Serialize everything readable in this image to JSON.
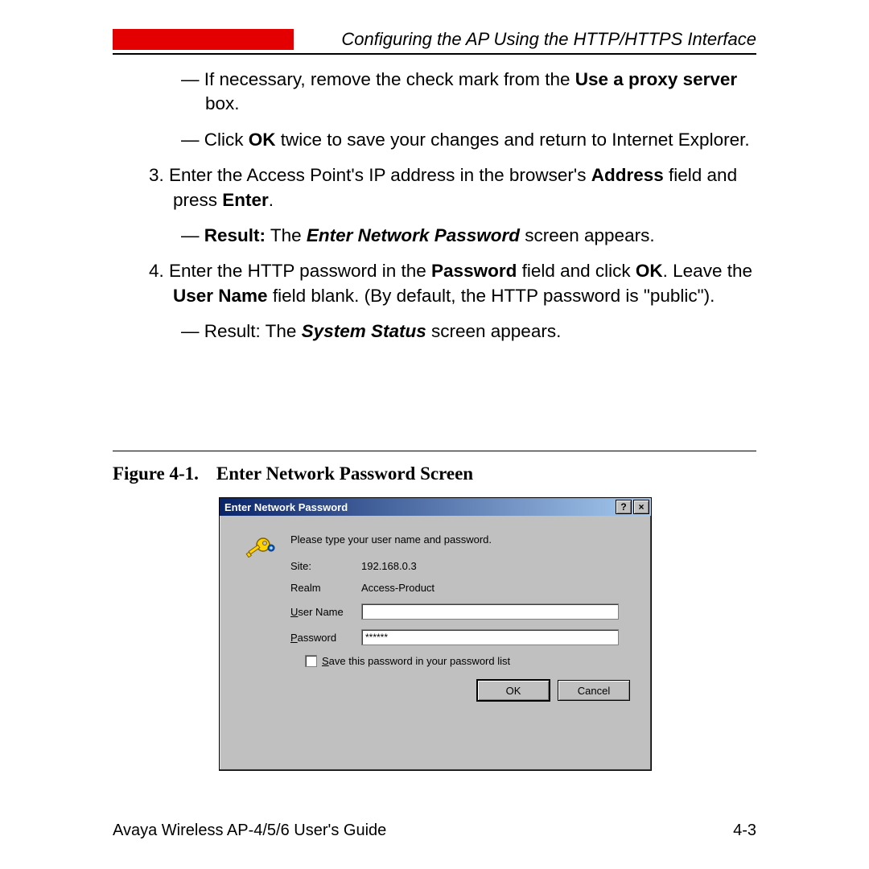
{
  "header": {
    "section_title": "Configuring the AP Using the HTTP/HTTPS Interface"
  },
  "body": {
    "dash1_pre": "If necessary, remove the check mark from the ",
    "dash1_bold": "Use a proxy server",
    "dash1_post": " box.",
    "dash2_pre": "Click ",
    "dash2_bold": "OK",
    "dash2_post": " twice to save your changes and return to Internet Explorer.",
    "step3_num": "3.  ",
    "step3_pre": "Enter the Access Point's IP address in the browser's ",
    "step3_bold1": "Address",
    "step3_mid": " field and press ",
    "step3_bold2": "Enter",
    "step3_post": ".",
    "dash3_bold1": "Result:",
    "dash3_mid": " The ",
    "dash3_bolditalic": "Enter Network Password",
    "dash3_post": " screen appears.",
    "step4_num": "4.  ",
    "step4_pre": "Enter the HTTP password in the ",
    "step4_bold1": "Password",
    "step4_mid1": " field and click ",
    "step4_bold2": "OK",
    "step4_mid2": ". Leave the ",
    "step4_bold3": "User Name",
    "step4_post": " field blank. (By default, the HTTP password is \"public\").",
    "dash4_pre": "Result: The ",
    "dash4_bolditalic": "System Status",
    "dash4_post": " screen appears."
  },
  "figure": {
    "number": "Figure 4-1.",
    "title": "Enter Network Password Screen"
  },
  "dialog": {
    "title": "Enter Network Password",
    "help_glyph": "?",
    "close_glyph": "×",
    "prompt": "Please type your user name and password.",
    "site_label": "Site:",
    "site_value": "192.168.0.3",
    "realm_label": "Realm",
    "realm_value": "Access-Product",
    "user_label_u": "U",
    "user_label_rest": "ser Name",
    "user_value": "",
    "pass_label_u": "P",
    "pass_label_rest": "assword",
    "pass_value": "******",
    "save_label_u": "S",
    "save_label_rest": "ave this password in your password list",
    "ok_label": "OK",
    "cancel_label": "Cancel"
  },
  "footer": {
    "left": "Avaya Wireless AP-4/5/6 User's Guide",
    "right": "4-3"
  }
}
